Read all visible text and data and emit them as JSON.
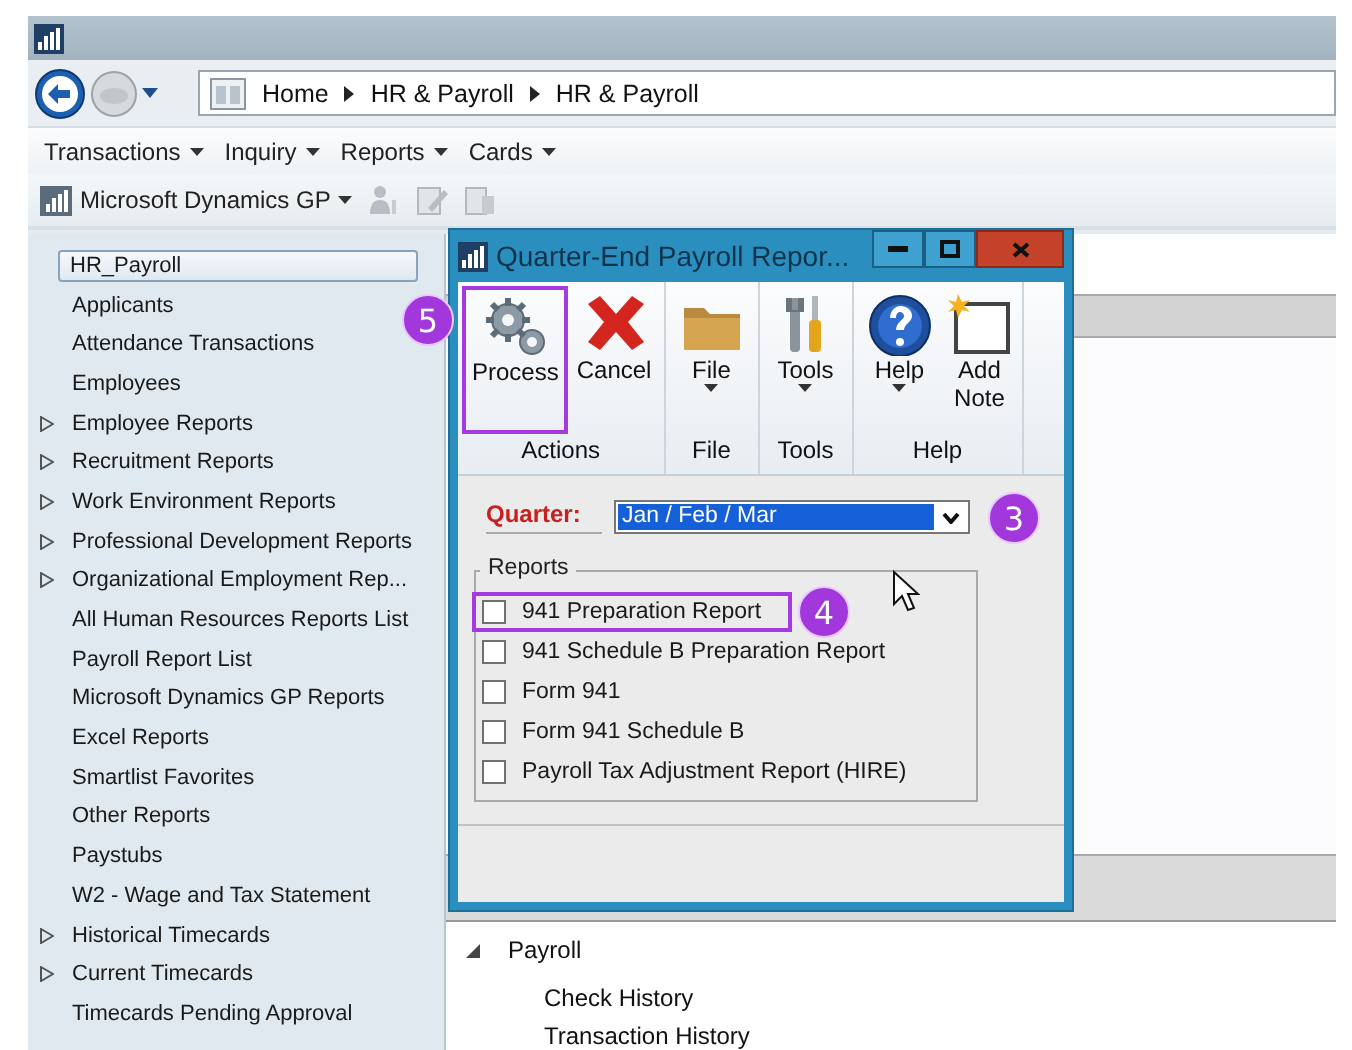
{
  "breadcrumb": [
    "Home",
    "HR & Payroll",
    "HR & Payroll"
  ],
  "menu": [
    {
      "label": "Transactions"
    },
    {
      "label": "Inquiry"
    },
    {
      "label": "Reports"
    },
    {
      "label": "Cards"
    }
  ],
  "toolbar": {
    "label": "Microsoft Dynamics GP"
  },
  "sidebar": {
    "items": [
      {
        "label": "HR_Payroll",
        "selected": true,
        "expandable": false
      },
      {
        "label": "Applicants",
        "selected": false,
        "expandable": false
      },
      {
        "label": "Attendance Transactions",
        "selected": false,
        "expandable": false
      },
      {
        "label": "Employees",
        "selected": false,
        "expandable": false
      },
      {
        "label": "Employee Reports",
        "selected": false,
        "expandable": true
      },
      {
        "label": "Recruitment Reports",
        "selected": false,
        "expandable": true
      },
      {
        "label": "Work Environment Reports",
        "selected": false,
        "expandable": true
      },
      {
        "label": "Professional Development Reports",
        "selected": false,
        "expandable": true
      },
      {
        "label": "Organizational Employment Rep...",
        "selected": false,
        "expandable": true
      },
      {
        "label": "All Human Resources Reports List",
        "selected": false,
        "expandable": false
      },
      {
        "label": "Payroll Report List",
        "selected": false,
        "expandable": false
      },
      {
        "label": "Microsoft Dynamics GP Reports",
        "selected": false,
        "expandable": false
      },
      {
        "label": "Excel Reports",
        "selected": false,
        "expandable": false
      },
      {
        "label": "Smartlist Favorites",
        "selected": false,
        "expandable": false
      },
      {
        "label": "Other Reports",
        "selected": false,
        "expandable": false
      },
      {
        "label": "Paystubs",
        "selected": false,
        "expandable": false
      },
      {
        "label": "W2 - Wage and Tax Statement",
        "selected": false,
        "expandable": false
      },
      {
        "label": "Historical Timecards",
        "selected": false,
        "expandable": true
      },
      {
        "label": "Current Timecards",
        "selected": false,
        "expandable": true
      },
      {
        "label": "Timecards Pending Approval",
        "selected": false,
        "expandable": false
      }
    ]
  },
  "dialog": {
    "title": "Quarter-End Payroll Repor...",
    "ribbon": [
      {
        "group": "Actions",
        "buttons": [
          {
            "label": "Process",
            "kind": "gears",
            "has_menu": false,
            "highlighted": true,
            "callout": "5"
          },
          {
            "label": "Cancel",
            "kind": "cross",
            "has_menu": false,
            "highlighted": false
          }
        ]
      },
      {
        "group": "File",
        "buttons": [
          {
            "label": "File",
            "kind": "folder",
            "has_menu": true,
            "highlighted": false
          }
        ]
      },
      {
        "group": "Tools",
        "buttons": [
          {
            "label": "Tools",
            "kind": "tools",
            "has_menu": true,
            "highlighted": false
          }
        ]
      },
      {
        "group": "Help",
        "buttons": [
          {
            "label": "Help",
            "kind": "help",
            "has_menu": true,
            "highlighted": false
          },
          {
            "label": "Add Note",
            "kind": "note",
            "has_menu": false,
            "highlighted": false
          }
        ]
      }
    ],
    "quarter": {
      "label": "Quarter:",
      "value": "Jan / Feb / Mar",
      "callout": "3"
    },
    "reports": {
      "legend": "Reports",
      "items": [
        {
          "label": "941 Preparation Report",
          "checked": false,
          "highlighted": true,
          "callout": "4"
        },
        {
          "label": "941 Schedule B Preparation Report",
          "checked": false,
          "highlighted": false
        },
        {
          "label": "Form 941",
          "checked": false,
          "highlighted": false
        },
        {
          "label": "Form 941 Schedule B",
          "checked": false,
          "highlighted": false
        },
        {
          "label": "Payroll Tax Adjustment Report (HIRE)",
          "checked": false,
          "highlighted": false
        }
      ]
    }
  },
  "navigation": {
    "tree": [
      {
        "label": "Payroll",
        "expanded": true,
        "children": [
          {
            "label": "Check History"
          },
          {
            "label": "Transaction History"
          }
        ]
      }
    ]
  }
}
